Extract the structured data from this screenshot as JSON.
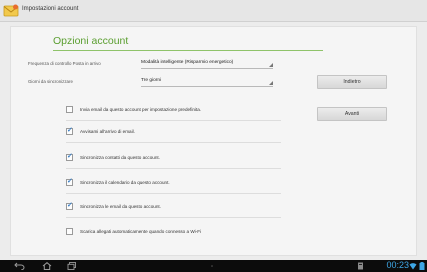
{
  "window": {
    "title": "Impostazioni account",
    "app_icon": "email-envelope-icon"
  },
  "page": {
    "title": "Opzioni account"
  },
  "fields": {
    "frequency": {
      "label": "Frequenza di controllo Posta in arrivo",
      "value": "Modalità intelligente (Risparmio energetico)"
    },
    "sync_days": {
      "label": "Giorni da sincronizzare",
      "value": "Tre giorni"
    }
  },
  "buttons": {
    "back": "Indietro",
    "next": "Avanti"
  },
  "options": [
    {
      "label": "Invia email da questo account per impostazione predefinita.",
      "checked": false
    },
    {
      "label": "Avvisami all'arrivo di email.",
      "checked": true
    },
    {
      "label": "Sincronizza contatti da questo account.",
      "checked": true
    },
    {
      "label": "Sincronizza il calendario da questo account.",
      "checked": true
    },
    {
      "label": "Sincronizza le email da questo account.",
      "checked": true
    },
    {
      "label": "Scarica allegati automaticamente quando connesso a Wi-Fi",
      "checked": false
    }
  ],
  "status_bar": {
    "time": "00:23",
    "nav_icons": [
      "back-icon",
      "home-icon",
      "recent-apps-icon",
      "menu-dots-icon"
    ],
    "status_icons": [
      "screenshot-icon",
      "wifi-icon",
      "battery-icon"
    ],
    "accent_color": "#3ea7e6"
  }
}
